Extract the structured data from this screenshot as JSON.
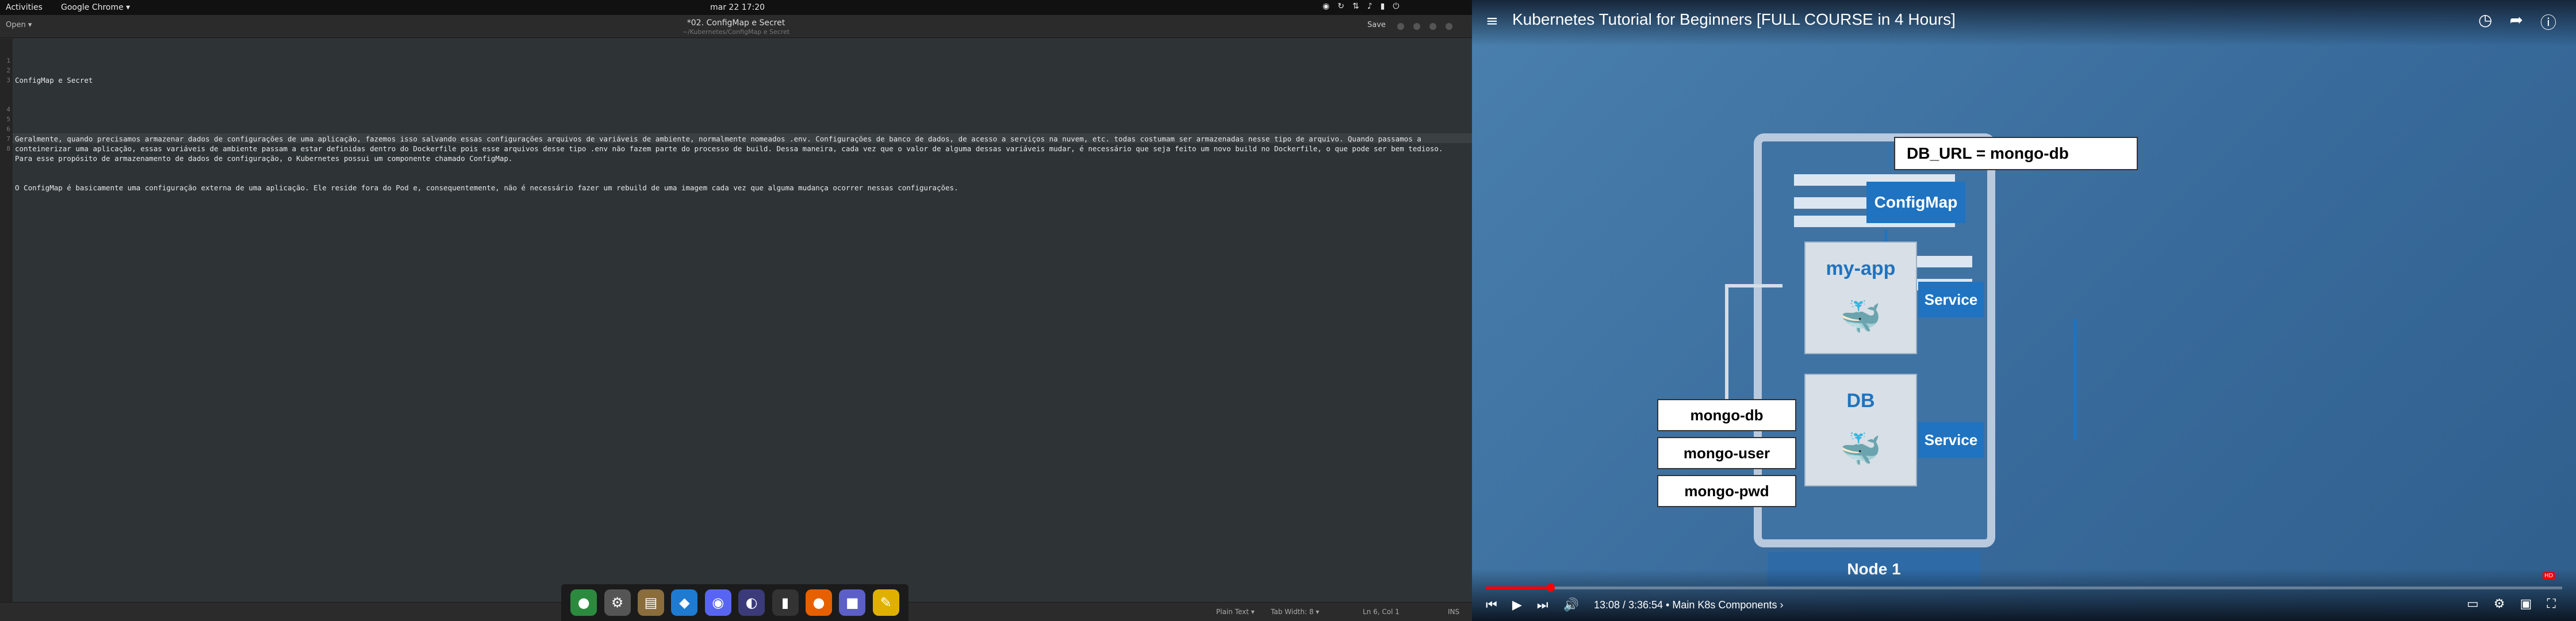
{
  "topbar": {
    "activities": "Activities",
    "app_menu": "Google Chrome ▾",
    "clock": "mar 22  17:20",
    "tray_icons": [
      "discord-tray-icon",
      "updates-icon",
      "network-icon",
      "volume-icon",
      "battery-icon",
      "power-icon"
    ]
  },
  "gedit": {
    "open_label": "Open ▾",
    "title": "*02. ConfigMap e Secret",
    "path": "~/Kubernetes/ConfigMap e Secret",
    "save_label": "Save",
    "line_numbers": [
      "1",
      "2",
      "3",
      "4",
      "5",
      "6",
      "7",
      "8"
    ],
    "lines": [
      "ConfigMap e Secret",
      "",
      "Geralmente, quando precisamos armazenar dados de configurações de uma aplicação, fazemos isso salvando essas configurações arquivos de variáveis de ambiente, normalmente nomeados .env. Configurações de banco de dados, de acesso a serviços na nuvem, etc. todas costumam ser armazenadas nesse tipo de arquivo. Quando passamos a conteinerizar uma aplicação, essas variáveis de ambiente passam a estar definidas dentro do Dockerfile pois esse arquivos desse tipo .env não fazem parte do processo de build. Dessa maneira, cada vez que o valor de alguma dessas variáveis mudar, é necessário que seja feito um novo build no Dockerfile, o que pode ser bem tedioso. Para esse propósito de armazenamento de dados de configuração, o Kubernetes possui um componente chamado ConfigMap.",
      "O ConfigMap é basicamente uma configuração externa de uma aplicação. Ele reside fora do Pod e, consequentemente, não é necessário fazer um rebuild de uma imagem cada vez que alguma mudança ocorrer nessas configurações.",
      "",
      "",
      "",
      ""
    ],
    "status": {
      "language": "Plain Text ▾",
      "tab_width": "Tab Width: 8 ▾",
      "position": "Ln 6, Col 1",
      "mode": "INS"
    }
  },
  "dock": {
    "apps": [
      {
        "name": "chrome-icon",
        "glyph": "●",
        "color": "#2b8a3e"
      },
      {
        "name": "settings-icon",
        "glyph": "⚙",
        "color": "#555"
      },
      {
        "name": "files-icon",
        "glyph": "▤",
        "color": "#8a6d3b"
      },
      {
        "name": "vscode-icon",
        "glyph": "◆",
        "color": "#1e7bd1"
      },
      {
        "name": "discord-icon",
        "glyph": "◉",
        "color": "#5865f2"
      },
      {
        "name": "eclipse-icon",
        "glyph": "◐",
        "color": "#3b3b7a"
      },
      {
        "name": "terminal-icon",
        "glyph": "▮",
        "color": "#333"
      },
      {
        "name": "firefox-icon",
        "glyph": "●",
        "color": "#e66000"
      },
      {
        "name": "teams-icon",
        "glyph": "■",
        "color": "#5b5fc7"
      },
      {
        "name": "text-editor-icon",
        "glyph": "✎",
        "color": "#e0b000"
      }
    ]
  },
  "youtube": {
    "title": "Kubernetes Tutorial for Beginners [FULL COURSE in 4 Hours]",
    "diagram": {
      "db_url": "DB_URL = mongo-db",
      "configmap": "ConfigMap",
      "app_pod": "my-app",
      "db_pod": "DB",
      "service_top": "Service",
      "service_bottom": "Service",
      "secret_items": [
        "mongo-db",
        "mongo-user",
        "mongo-pwd"
      ],
      "node": "Node 1"
    },
    "player": {
      "time": "13:08 / 3:36:54 • Main K8s Components ›",
      "progress_fraction": 0.0605,
      "quality_badge": "HD"
    }
  },
  "colors": {
    "accent_blue": "#1f73c0",
    "progress_red": "#ff0000"
  }
}
